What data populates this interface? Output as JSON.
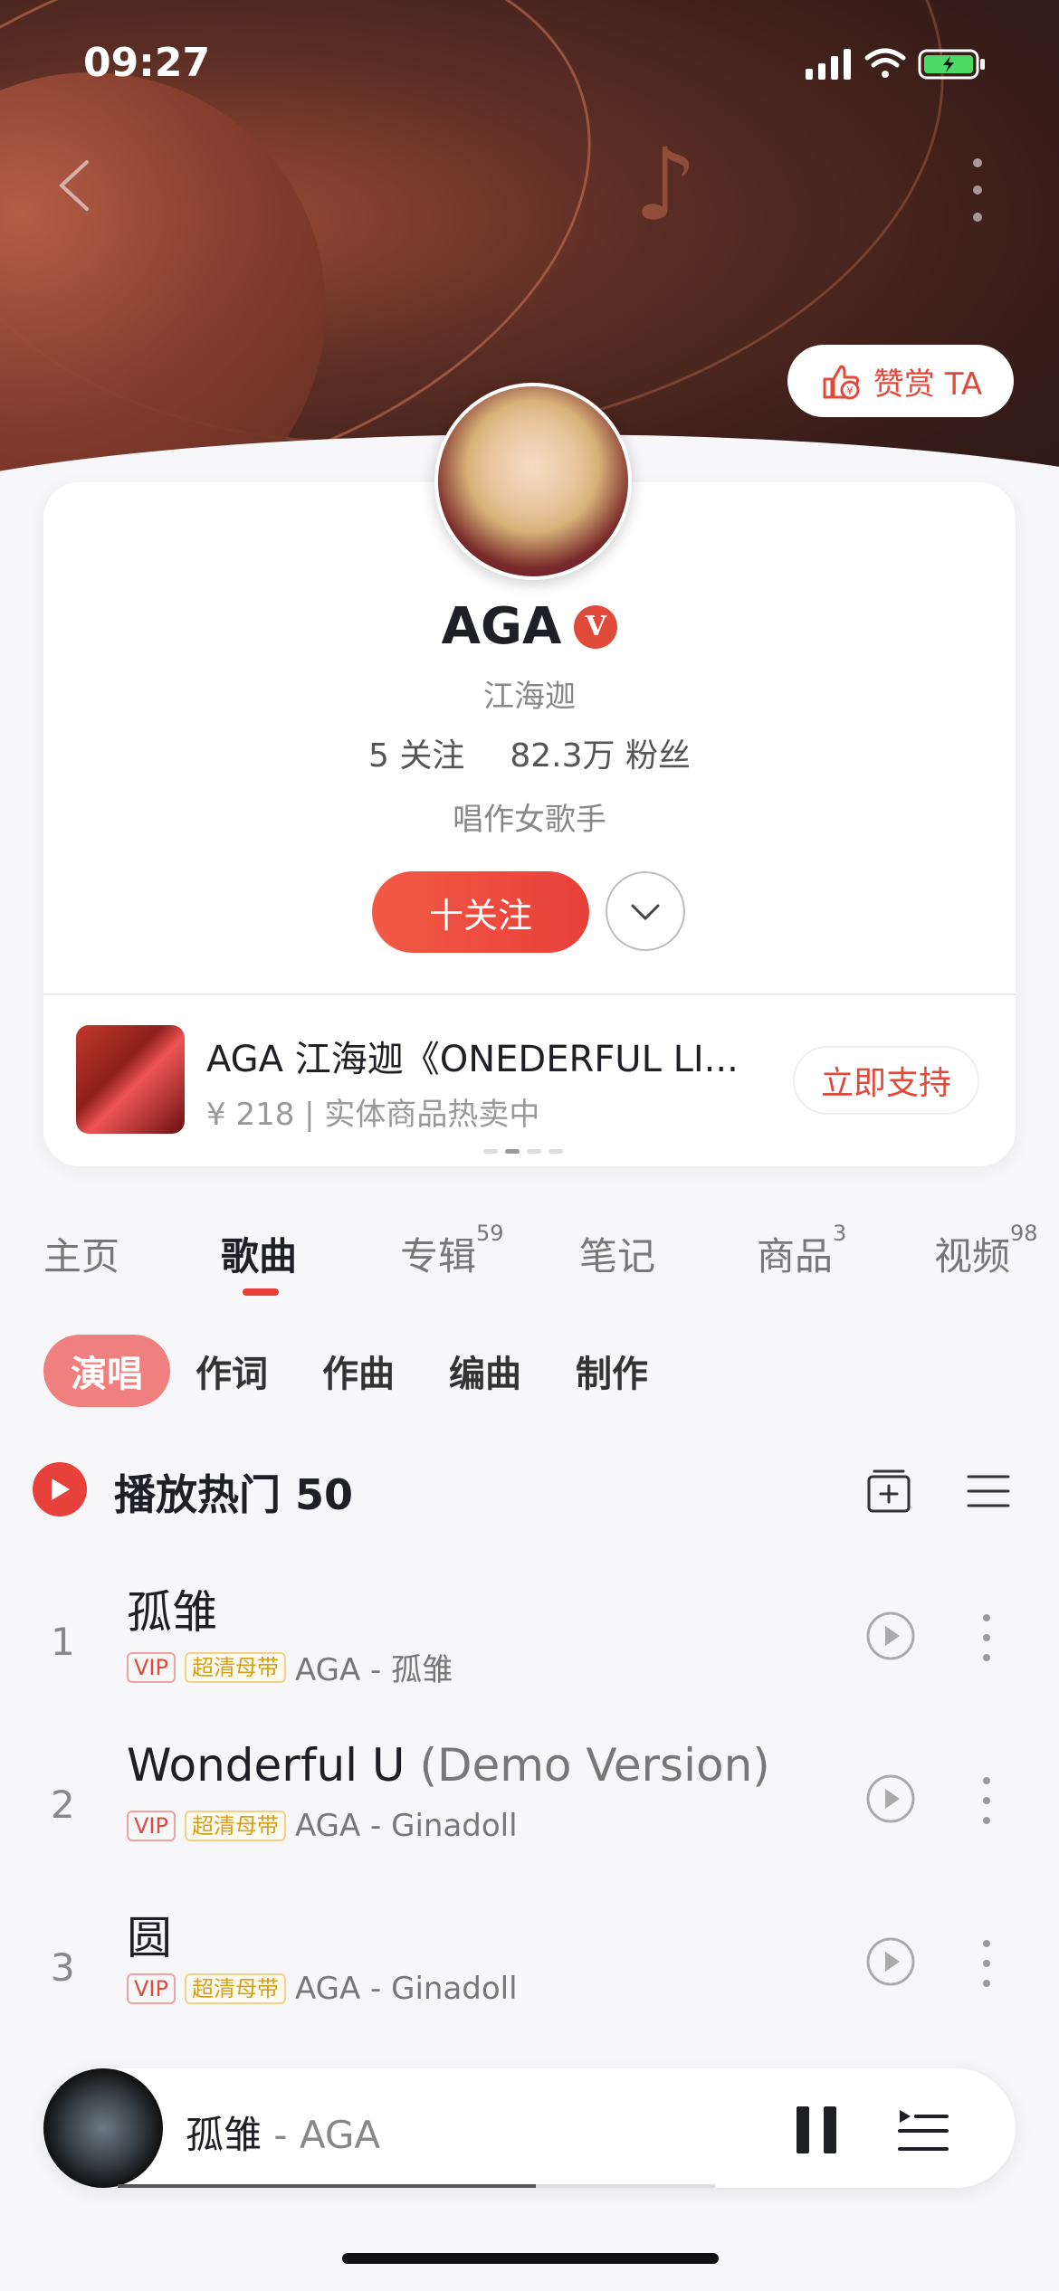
{
  "status_bar": {
    "time": "09:27"
  },
  "header": {
    "tip_button_label": "赞赏 TA"
  },
  "profile": {
    "name": "AGA",
    "verified_mark": "V",
    "alias": "江海迦",
    "following_count": "5",
    "following_label": "关注",
    "followers_count": "82.3万",
    "followers_label": "粉丝",
    "bio": "唱作女歌手",
    "follow_button": "十关注"
  },
  "product": {
    "title": "AGA 江海迦《ONEDERFUL LI...",
    "subtitle": "¥ 218 | 实体商品热卖中",
    "support_button": "立即支持"
  },
  "tabs": [
    {
      "label": "主页",
      "count": ""
    },
    {
      "label": "歌曲",
      "count": ""
    },
    {
      "label": "专辑",
      "count": "59"
    },
    {
      "label": "笔记",
      "count": ""
    },
    {
      "label": "商品",
      "count": "3"
    },
    {
      "label": "视频",
      "count": "98"
    }
  ],
  "sub_tabs": [
    "演唱",
    "作词",
    "作曲",
    "编曲",
    "制作"
  ],
  "play_hot": {
    "label": "播放热门 50"
  },
  "songs": [
    {
      "index": "1",
      "title": "孤雏",
      "title_suffix": "",
      "vip": "VIP",
      "quality": "超清母带",
      "meta": "AGA - 孤雏"
    },
    {
      "index": "2",
      "title": "Wonderful U",
      "title_suffix": "(Demo Version)",
      "vip": "VIP",
      "quality": "超清母带",
      "meta": "AGA - Ginadoll"
    },
    {
      "index": "3",
      "title": "圆",
      "title_suffix": "",
      "vip": "VIP",
      "quality": "超清母带",
      "meta": "AGA - Ginadoll"
    }
  ],
  "player": {
    "song": "孤雏",
    "artist_sep": " - AGA",
    "progress": 0.7
  },
  "colors": {
    "accent": "#e8403a",
    "background": "#f7f7f9"
  }
}
